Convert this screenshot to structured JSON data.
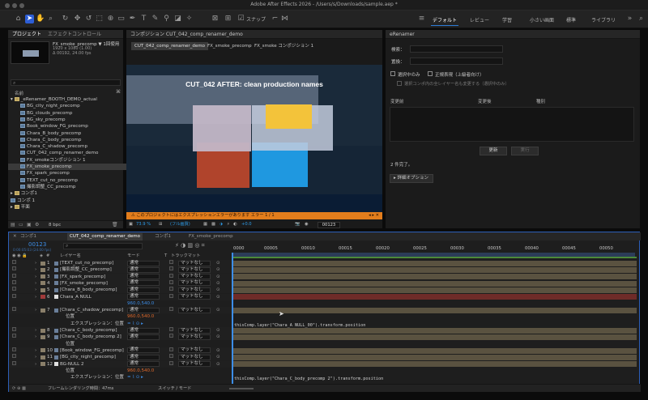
{
  "window": {
    "title": "Adobe After Effects 2026 - /Users/s/Downloads/sample.aep *"
  },
  "toolbar": {
    "snapping_label": "スナップ"
  },
  "workspaces": [
    {
      "label": "デフォルト",
      "active": true
    },
    {
      "label": "レビュー",
      "active": false
    },
    {
      "label": "学習",
      "active": false
    },
    {
      "label": "小さい画面",
      "active": false
    },
    {
      "label": "標準",
      "active": false
    },
    {
      "label": "ライブラリ",
      "active": false
    }
  ],
  "project_panel": {
    "tab_project": "プロジェクト",
    "tab_effects": "エフェクトコントロール",
    "selected_name": "FX_smoke_precomp ▼ 1回使用",
    "info_lines": [
      "1920 x 1080 (1.00)",
      "Δ 00192, 24.00 fps"
    ],
    "search_placeholder": "",
    "column_name": "名前",
    "items": [
      {
        "label": "_eRenamer_BOOTH_DEMO_actual",
        "type": "folder",
        "indent": 0,
        "selected": false
      },
      {
        "label": "BG_city_night_precomp",
        "type": "comp",
        "indent": 1,
        "selected": false
      },
      {
        "label": "BG_clouds_precomp",
        "type": "comp",
        "indent": 1,
        "selected": false
      },
      {
        "label": "BG_sky_precomp",
        "type": "comp",
        "indent": 1,
        "selected": false
      },
      {
        "label": "Book_window_FG_precomp",
        "type": "comp",
        "indent": 1,
        "selected": false
      },
      {
        "label": "Chara_B_body_precomp",
        "type": "comp",
        "indent": 1,
        "selected": false
      },
      {
        "label": "Chara_C_body_precomp",
        "type": "comp",
        "indent": 1,
        "selected": false
      },
      {
        "label": "Chara_C_shadow_precomp",
        "type": "comp",
        "indent": 1,
        "selected": false
      },
      {
        "label": "CUT_042_comp_renamer_demo",
        "type": "comp",
        "indent": 1,
        "selected": false
      },
      {
        "label": "FX_smokeコンポジション 1",
        "type": "comp",
        "indent": 1,
        "selected": false
      },
      {
        "label": "FX_smoke_precomp",
        "type": "comp",
        "indent": 1,
        "selected": true
      },
      {
        "label": "FX_spark_precomp",
        "type": "comp",
        "indent": 1,
        "selected": false
      },
      {
        "label": "TEXT_cut_no_precomp",
        "type": "comp",
        "indent": 1,
        "selected": false
      },
      {
        "label": "撮影調整_CC_precomp",
        "type": "comp",
        "indent": 1,
        "selected": false
      },
      {
        "label": "コンポ1",
        "type": "folder",
        "indent": 0,
        "selected": false
      },
      {
        "label": "コンポ 1",
        "type": "comp",
        "indent": 0,
        "selected": false
      },
      {
        "label": "平面",
        "type": "folder",
        "indent": 0,
        "selected": false
      }
    ],
    "footer_bpc": "8 bpc"
  },
  "composition_panel": {
    "tab_label": "コンポジション CUT_042_comp_renamer_demo",
    "breadcrumbs": [
      "CUT_042_comp_renamer_demo",
      "FX_smoke_precomp",
      "FX_smoke コンポジション 1"
    ],
    "overlay_title": "CUT_042  AFTER: clean production names",
    "warning": "このプロジェクトにはエクスプレッションエラーがあります  エラー 1 / 1",
    "zoom": "73.9 %",
    "resolution": "(フル画質)",
    "timecode": "00123",
    "view_label": "+0.0"
  },
  "erenamer": {
    "title": "eRenamer",
    "search_label": "検索：",
    "replace_label": "置換：",
    "opt_selected_only": "選択中のみ",
    "opt_regex": "正規表現（上級者向け）",
    "opt_layers": "選択コンポ内の全レイヤー名も変更する（選択中のみ）",
    "col_before": "変更前",
    "col_after": "変更後",
    "col_type": "種別",
    "btn_update": "更新",
    "btn_run": "実行",
    "status": "2 件完了。",
    "detail_toggle": "▸ 詳細オプション"
  },
  "timeline": {
    "tabs": [
      "コンポ1",
      "CUT_042_comp_renamer_demo",
      "コンポ1",
      "FX_smoke_precomp"
    ],
    "timecode": "00123",
    "timecode_sub": "0:00:05:03 (24.00 fps)",
    "search_placeholder": "",
    "col_layer": "レイヤー名",
    "col_mode": "モード",
    "col_t": "T",
    "col_track": "トラックマット",
    "ruler": [
      "0000",
      "00005",
      "00010",
      "00015",
      "00020",
      "00025",
      "00030",
      "00035",
      "00040",
      "00045",
      "00050"
    ],
    "layers": [
      {
        "num": "1",
        "name": "[TEXT_cut_no_precomp]",
        "mode": "通常",
        "track": "マットなし",
        "label_color": "#8a7f6a",
        "kind": "layer"
      },
      {
        "num": "2",
        "name": "[撮影調整_CC_precomp]",
        "mode": "通常",
        "track": "マットなし",
        "label_color": "#8a7f6a",
        "kind": "layer"
      },
      {
        "num": "3",
        "name": "[FX_spark_precomp]",
        "mode": "通常",
        "track": "マットなし",
        "label_color": "#8a7f6a",
        "kind": "layer"
      },
      {
        "num": "4",
        "name": "[FX_smoke_precomp]",
        "mode": "通常",
        "track": "マットなし",
        "label_color": "#8a7f6a",
        "kind": "layer"
      },
      {
        "num": "5",
        "name": "[Chara_B_body_precomp]",
        "mode": "通常",
        "track": "マットなし",
        "label_color": "#8a7f6a",
        "kind": "layer"
      },
      {
        "num": "6",
        "name": "Chara_A NULL",
        "mode": "通常",
        "track": "マットなし",
        "label_color": "#a03a3a",
        "kind": "null"
      },
      {
        "num": "",
        "name": "",
        "mode": "960.0,540.0",
        "track": "",
        "label_color": "",
        "kind": "value"
      },
      {
        "num": "7",
        "name": "[Chara_C_shadow_precomp]",
        "mode": "通常",
        "track": "マットなし",
        "label_color": "#8a7f6a",
        "kind": "layer"
      },
      {
        "num": "",
        "name": "位置",
        "mode": "960.0,540.0",
        "track": "",
        "label_color": "",
        "kind": "prop"
      },
      {
        "num": "",
        "name": "エクスプレッション：位置",
        "mode": "",
        "track": "",
        "label_color": "",
        "kind": "expr"
      },
      {
        "num": "8",
        "name": "[Chara_C_body_precomp]",
        "mode": "通常",
        "track": "マットなし",
        "label_color": "#8a7f6a",
        "kind": "layer"
      },
      {
        "num": "9",
        "name": "[Chara_C_body_precomp 2]",
        "mode": "通常",
        "track": "マットなし",
        "label_color": "#8a7f6a",
        "kind": "layer"
      },
      {
        "num": "",
        "name": "位置",
        "mode": "",
        "track": "",
        "label_color": "",
        "kind": "prop"
      },
      {
        "num": "10",
        "name": "[Book_window_FG_precomp]",
        "mode": "通常",
        "track": "マットなし",
        "label_color": "#8a7f6a",
        "kind": "layer"
      },
      {
        "num": "11",
        "name": "[BG_city_night_precomp]",
        "mode": "通常",
        "track": "マットなし",
        "label_color": "#8a7f6a",
        "kind": "layer"
      },
      {
        "num": "12",
        "name": "BG-NULL 2",
        "mode": "通常",
        "track": "マットなし",
        "label_color": "#8a7f6a",
        "kind": "null"
      },
      {
        "num": "",
        "name": "位置",
        "mode": "960.0,540.0",
        "track": "",
        "label_color": "",
        "kind": "prop"
      },
      {
        "num": "",
        "name": "エクスプレッション：位置",
        "mode": "",
        "track": "",
        "label_color": "",
        "kind": "expr"
      }
    ],
    "expr1": "thisComp.layer(\"Chara_A NULL_00\").transform.position",
    "expr2": "thisComp.layer(\"Chara_C_body_precomp 2\").transform.position",
    "footer_render": "フレームレンダリング時間：",
    "footer_ms": "47ms",
    "footer_switch": "スイッチ / モード"
  }
}
